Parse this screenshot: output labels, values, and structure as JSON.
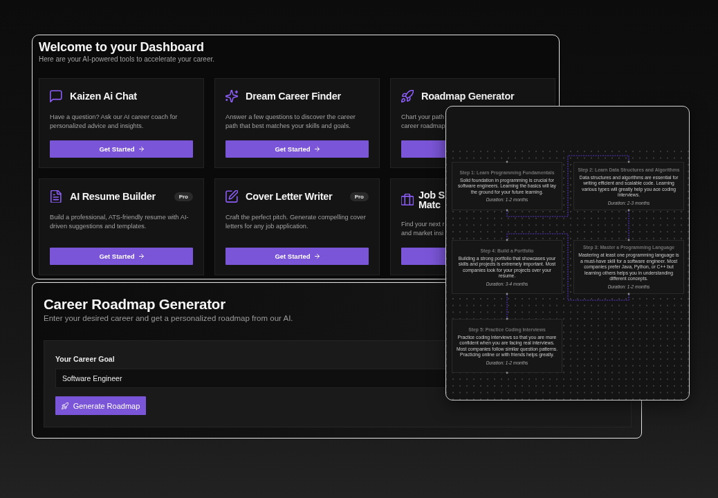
{
  "dashboard": {
    "title": "Welcome to your Dashboard",
    "subtitle": "Here are your AI-powered tools to accelerate your career.",
    "tools": [
      {
        "title": "Kaizen Ai Chat",
        "description": "Have a question? Ask our AI career coach for personalized advice and insights.",
        "button": "Get Started"
      },
      {
        "title": "Dream Career Finder",
        "description": "Answer a few questions to discover the career path that best matches your skills and goals.",
        "button": "Get Started"
      },
      {
        "title": "Roadmap Generator",
        "description_lines": [
          "Chart your path",
          "career roadmap"
        ]
      },
      {
        "title": "AI Resume Builder",
        "badge": "Pro",
        "description": "Build a professional, ATS-friendly resume with AI-driven suggestions and templates.",
        "button": "Get Started"
      },
      {
        "title": "Cover Letter Writer",
        "badge": "Pro",
        "description": "Craft the perfect pitch. Generate compelling cover letters for any job application.",
        "button": "Get Started"
      },
      {
        "title_lines": [
          "Job S",
          "Matc"
        ],
        "description_lines": [
          "Find your next r",
          "and market insi"
        ]
      }
    ]
  },
  "roadmap_generator": {
    "title": "Career Roadmap Generator",
    "subtitle": "Enter your desired career and get a personalized roadmap from our AI.",
    "field": {
      "label": "Your Career Goal",
      "value": "Software Engineer"
    },
    "button": "Generate Roadmap"
  },
  "roadmap_preview": {
    "steps": [
      {
        "title": "Step 1: Learn Programming Fundamentals",
        "description": "Solid foundation in programming is crucial for software engineers. Learning the basics will lay the ground for your future learning.",
        "duration": "Duration: 1-2 months"
      },
      {
        "title": "Step 2: Learn Data Structures and Algorithms",
        "description": "Data structures and algorithms are essential for writing efficient and scalable code. Learning various types will greatly help you ace coding interviews.",
        "duration": "Duration: 2-3 months"
      },
      {
        "title": "Step 4: Build a Portfolio",
        "description": "Building a strong portfolio that showcases your skills and projects is extremely important. Most companies look for your projects over your resume.",
        "duration": "Duration: 3-4 months"
      },
      {
        "title": "Step 3: Master a Programming Language",
        "description": "Mastering at least one programming language is a must-have skill for a software engineer. Most companies prefer Java, Python, or C++ but learning others helps you in understanding different concepts.",
        "duration": "Duration: 1-2 months"
      },
      {
        "title": "Step 5: Practice Coding Interviews",
        "description": "Practice coding interviews so that you are more confident when you are facing real interviews. Most companies follow similar question patterns. Practicing online or with friends helps greatly.",
        "duration": "Duration: 1-2 months"
      }
    ]
  }
}
